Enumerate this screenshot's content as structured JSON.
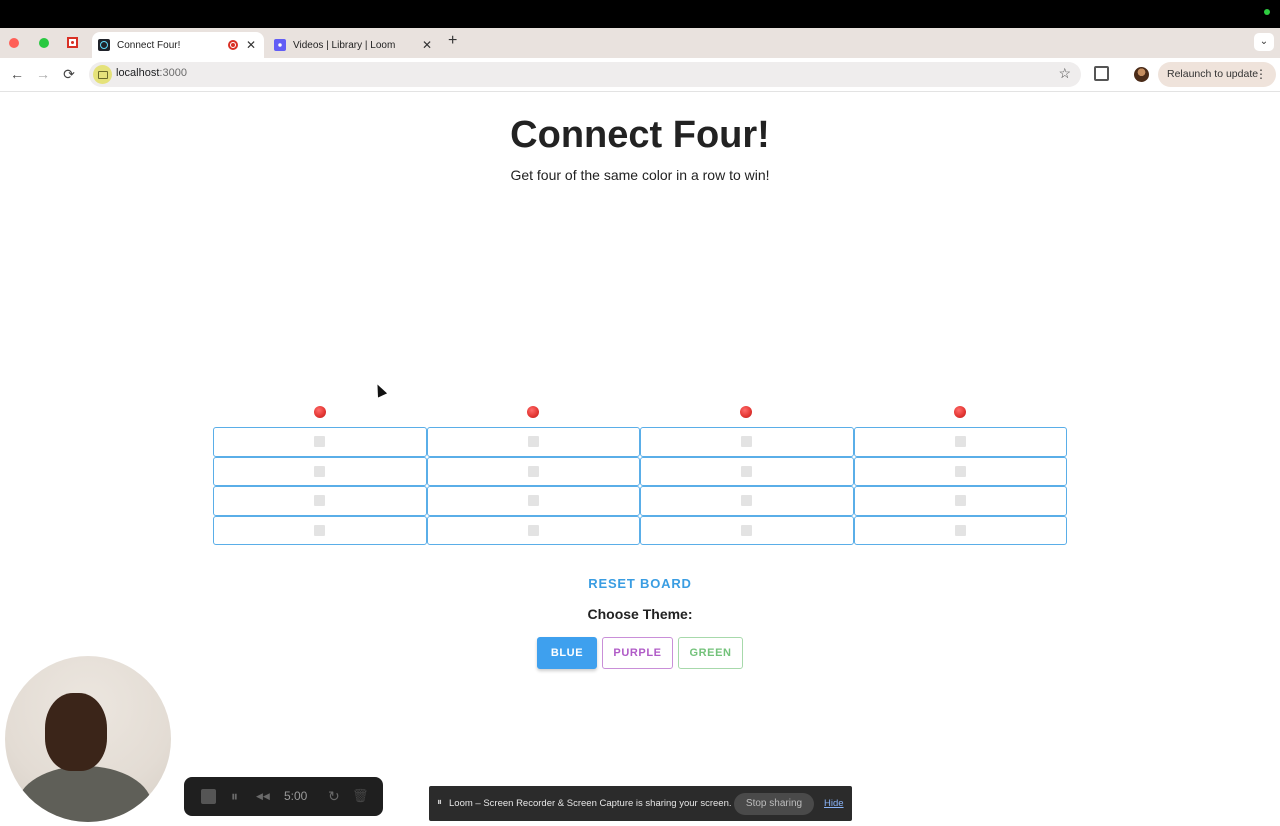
{
  "browser": {
    "tabs": [
      {
        "title": "Connect Four!",
        "active": true
      },
      {
        "title": "Videos | Library | Loom",
        "active": false
      }
    ],
    "new_tab_label": "+",
    "tab_menu_label": "⌄",
    "url_host": "localhost",
    "url_port": ":3000",
    "relaunch_label": "Relaunch to update",
    "relaunch_dots": "⋮",
    "back": "←",
    "forward": "→",
    "reload": "⟳",
    "star": "☆",
    "close": "✕"
  },
  "game": {
    "title": "Connect Four!",
    "subtitle": "Get four of the same color in a row to win!",
    "columns": 4,
    "rows": 4,
    "drop_token_color": "#e53935",
    "reset_label": "RESET BOARD",
    "theme_label": "Choose Theme:",
    "themes": [
      {
        "label": "BLUE",
        "selected": true,
        "color": "#3ea0ee"
      },
      {
        "label": "PURPLE",
        "selected": false,
        "color": "#b05bc7"
      },
      {
        "label": "GREEN",
        "selected": false,
        "color": "#73c27a"
      }
    ]
  },
  "loom": {
    "timer": "5:00",
    "pause_icon": "⏸",
    "rewind_icon": "◀◀",
    "restart_icon": "↻",
    "trash_icon": "🗑",
    "share_pause_icon": "⏸",
    "share_message": "Loom – Screen Recorder & Screen Capture is sharing your screen.",
    "stop_sharing_label": "Stop sharing",
    "hide_label": "Hide"
  }
}
